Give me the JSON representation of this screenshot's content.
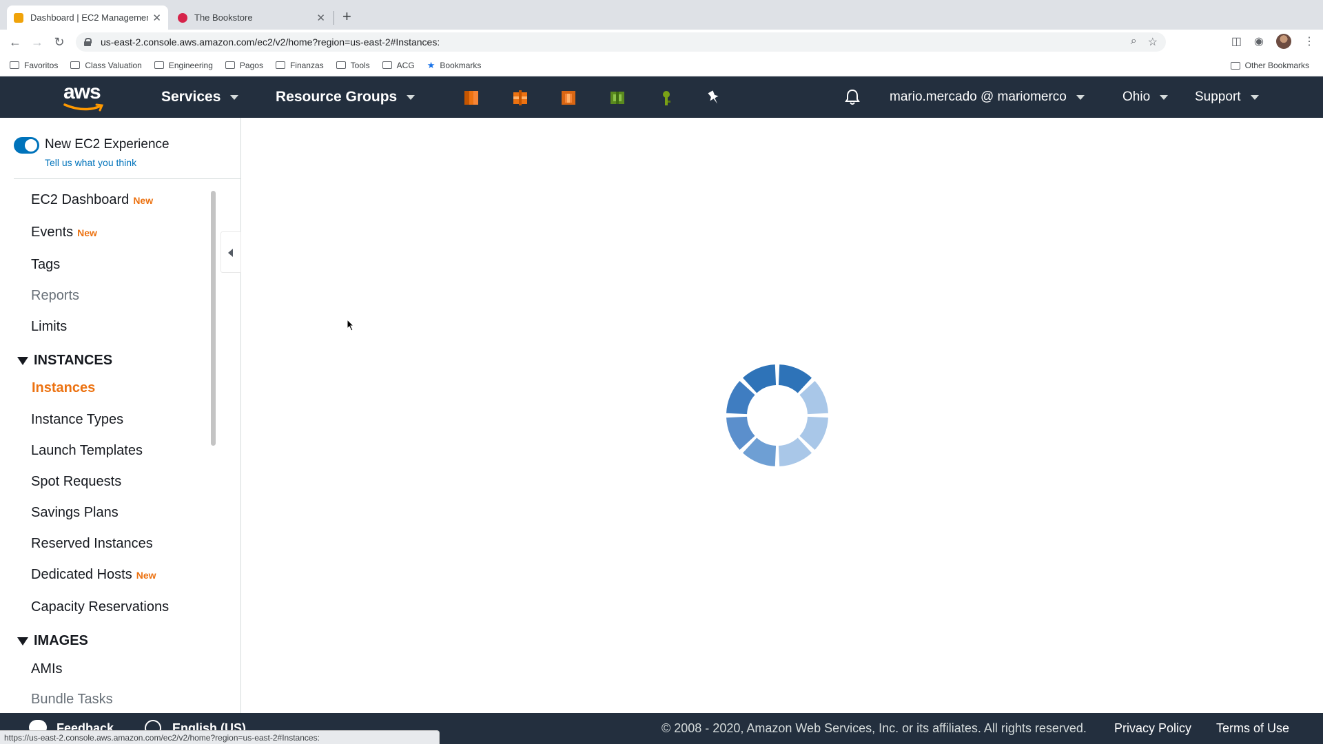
{
  "browser": {
    "tabs": [
      {
        "title": "Dashboard | EC2 Management",
        "favicon_color": "#f0a30a",
        "active": true
      },
      {
        "title": "The Bookstore",
        "favicon_color": "#d6234a",
        "active": false
      }
    ],
    "url": "us-east-2.console.aws.amazon.com/ec2/v2/home?region=us-east-2#Instances:",
    "bookmarks": [
      "Favoritos",
      "Class Valuation",
      "Engineering",
      "Pagos",
      "Finanzas",
      "Tools",
      "ACG",
      "Bookmarks"
    ],
    "other_bookmarks": "Other Bookmarks",
    "status_url": "https://us-east-2.console.aws.amazon.com/ec2/v2/home?region=us-east-2#Instances:"
  },
  "aws_header": {
    "logo": "aws",
    "services": "Services",
    "resource_groups": "Resource Groups",
    "shortcut_icons": [
      "ec2-icon",
      "s3-icon",
      "lambda-icon",
      "rds-icon",
      "iam-icon",
      "pin-icon"
    ],
    "account": "mario.mercado @ mariomerco",
    "region": "Ohio",
    "support": "Support"
  },
  "sidebar": {
    "toggle_label": "New EC2 Experience",
    "feedback_link": "Tell us what you think",
    "new_badge": "New",
    "items": [
      {
        "label": "EC2 Dashboard",
        "badge": "New"
      },
      {
        "label": "Events",
        "badge": "New"
      },
      {
        "label": "Tags"
      },
      {
        "label": "Reports"
      },
      {
        "label": "Limits"
      }
    ],
    "instances_section": "INSTANCES",
    "instances_items": [
      {
        "label": "Instances"
      },
      {
        "label": "Instance Types"
      },
      {
        "label": "Launch Templates"
      },
      {
        "label": "Spot Requests"
      },
      {
        "label": "Savings Plans"
      },
      {
        "label": "Reserved Instances"
      },
      {
        "label": "Dedicated Hosts",
        "badge": "New"
      },
      {
        "label": "Capacity Reservations"
      }
    ],
    "images_section": "IMAGES",
    "images_items": [
      {
        "label": "AMIs"
      },
      {
        "label": "Bundle Tasks"
      }
    ]
  },
  "footer": {
    "feedback": "Feedback",
    "language": "English (US)",
    "copyright": "© 2008 - 2020, Amazon Web Services, Inc. or its affiliates. All rights reserved.",
    "privacy": "Privacy Policy",
    "terms": "Terms of Use"
  },
  "colors": {
    "aws_nav_bg": "#232f3e",
    "accent_orange": "#ec7211",
    "link_blue": "#0073bb",
    "spinner_dark": "#2e73b8",
    "spinner_light": "#a9c7e8"
  }
}
